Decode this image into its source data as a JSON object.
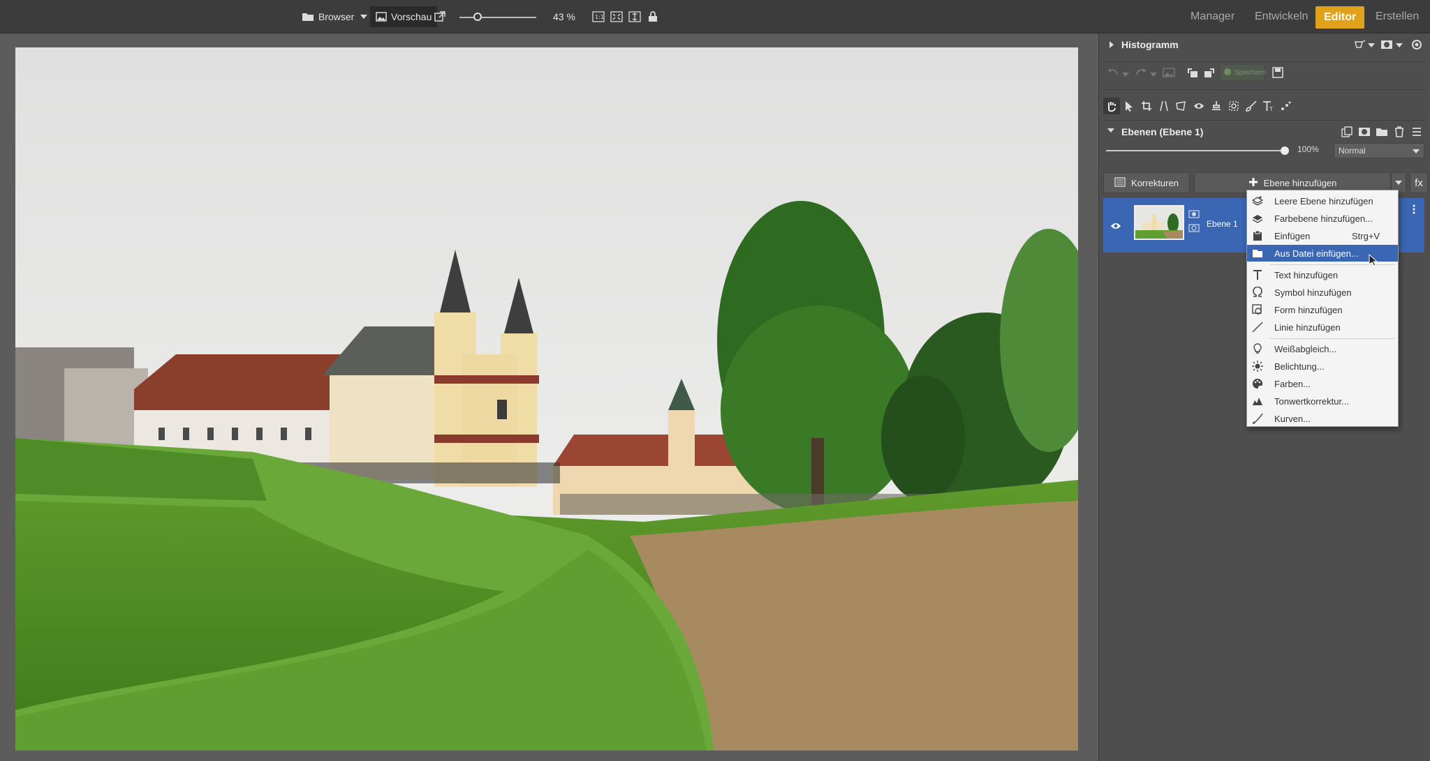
{
  "toolbar": {
    "browser_label": "Browser",
    "preview_label": "Vorschau",
    "zoom_value": "43 %",
    "zoom_slider_fraction": 0.24
  },
  "modes": {
    "manager": "Manager",
    "develop": "Entwickeln",
    "editor": "Editor",
    "create": "Erstellen",
    "accent_color": "#e0a11b"
  },
  "panel": {
    "histogram_title": "Histogramm",
    "save_label": "Speichern",
    "layers_title": "Ebenen (Ebene 1)",
    "opacity": "100%",
    "blend_mode": "Normal",
    "corrections_label": "Korrekturen",
    "add_layer_label": "Ebene hinzufügen",
    "fx_label": "fx",
    "layer_name": "Ebene 1",
    "selection_color": "#3a66b3"
  },
  "menu": {
    "items": [
      {
        "label": "Leere Ebene hinzufügen",
        "icon": "empty-layer-icon"
      },
      {
        "label": "Farbebene hinzufügen...",
        "icon": "color-layer-icon"
      },
      {
        "label": "Einfügen",
        "shortcut": "Strg+V",
        "icon": "paste-icon"
      },
      {
        "label": "Aus Datei einfügen...",
        "icon": "insert-file-icon"
      },
      {
        "label": "Text hinzufügen",
        "icon": "text-icon"
      },
      {
        "label": "Symbol hinzufügen",
        "icon": "omega-icon"
      },
      {
        "label": "Form hinzufügen",
        "icon": "shape-icon"
      },
      {
        "label": "Linie hinzufügen",
        "icon": "line-icon"
      },
      {
        "label": "Weißabgleich...",
        "icon": "bulb-icon"
      },
      {
        "label": "Belichtung...",
        "icon": "sun-icon"
      },
      {
        "label": "Farben...",
        "icon": "palette-icon"
      },
      {
        "label": "Tonwertkorrektur...",
        "icon": "levels-icon"
      },
      {
        "label": "Kurven...",
        "icon": "curves-icon"
      }
    ]
  }
}
